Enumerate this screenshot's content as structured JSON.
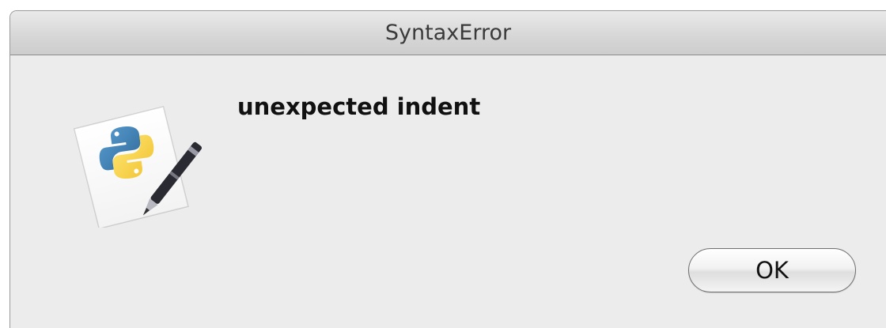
{
  "dialog": {
    "title": "SyntaxError",
    "message": "unexpected indent",
    "icon": "python-launcher-icon",
    "ok_label": "OK"
  },
  "colors": {
    "window_background": "#ececec",
    "python_blue": "#3b78c0",
    "python_yellow": "#f2cc3a"
  }
}
